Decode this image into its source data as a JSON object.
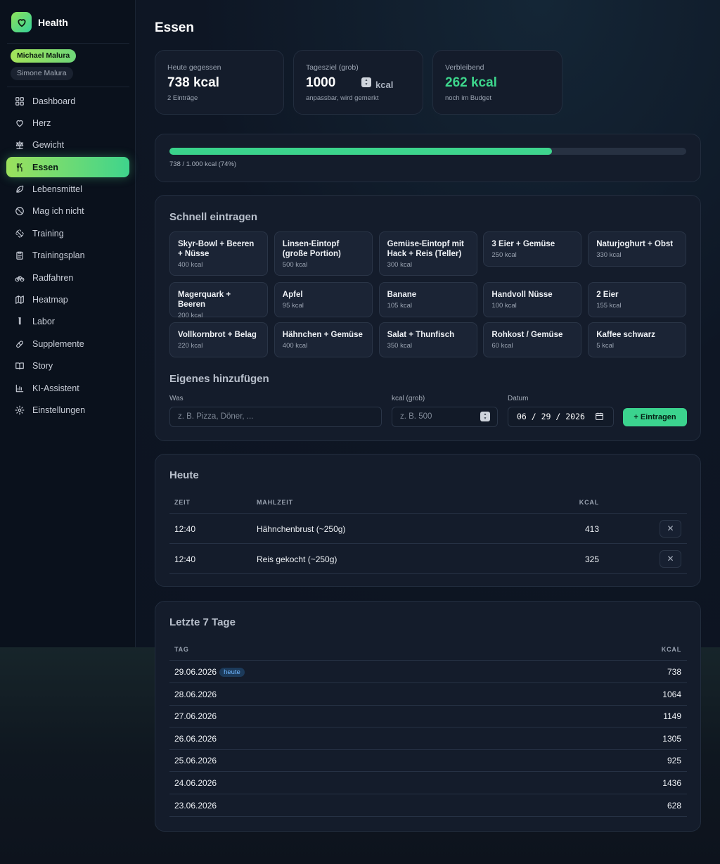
{
  "app": {
    "name": "Health"
  },
  "users": {
    "active": "Michael Malura",
    "other": "Simone Malura"
  },
  "sidebar": {
    "items": [
      {
        "label": "Dashboard",
        "icon": "dashboard-icon"
      },
      {
        "label": "Herz",
        "icon": "heart-icon"
      },
      {
        "label": "Gewicht",
        "icon": "scale-icon"
      },
      {
        "label": "Essen",
        "icon": "utensils-icon",
        "active": true
      },
      {
        "label": "Lebensmittel",
        "icon": "leaf-icon"
      },
      {
        "label": "Mag ich nicht",
        "icon": "ban-icon"
      },
      {
        "label": "Training",
        "icon": "dumbbell-icon"
      },
      {
        "label": "Trainingsplan",
        "icon": "clipboard-icon"
      },
      {
        "label": "Radfahren",
        "icon": "bike-icon"
      },
      {
        "label": "Heatmap",
        "icon": "map-icon"
      },
      {
        "label": "Labor",
        "icon": "test-tube-icon"
      },
      {
        "label": "Supplemente",
        "icon": "pill-icon"
      },
      {
        "label": "Story",
        "icon": "book-icon"
      },
      {
        "label": "KI-Assistent",
        "icon": "bar-chart-icon"
      },
      {
        "label": "Einstellungen",
        "icon": "gear-icon"
      }
    ]
  },
  "page": {
    "title": "Essen"
  },
  "stats": {
    "eaten": {
      "label": "Heute gegessen",
      "value": "738 kcal",
      "sub": "2 Einträge"
    },
    "goal": {
      "label": "Tagesziel (grob)",
      "value": "1000",
      "unit": "kcal",
      "sub": "anpassbar, wird gemerkt"
    },
    "remaining": {
      "label": "Verbleibend",
      "value": "262 kcal",
      "sub": "noch im Budget"
    }
  },
  "progress": {
    "fraction": 0.74,
    "text": "738 / 1.000 kcal (74%)"
  },
  "quick": {
    "title": "Schnell eintragen",
    "items": [
      {
        "name": "Skyr-Bowl + Beeren + Nüsse",
        "kcal": "400 kcal"
      },
      {
        "name": "Linsen-Eintopf (große Portion)",
        "kcal": "500 kcal"
      },
      {
        "name": "Gemüse-Eintopf mit Hack + Reis (Teller)",
        "kcal": "300 kcal"
      },
      {
        "name": "3 Eier + Gemüse",
        "kcal": "250 kcal"
      },
      {
        "name": "Naturjoghurt + Obst",
        "kcal": "330 kcal"
      },
      {
        "name": "Magerquark + Beeren",
        "kcal": "200 kcal"
      },
      {
        "name": "Apfel",
        "kcal": "95 kcal"
      },
      {
        "name": "Banane",
        "kcal": "105 kcal"
      },
      {
        "name": "Handvoll Nüsse",
        "kcal": "100 kcal"
      },
      {
        "name": "2 Eier",
        "kcal": "155 kcal"
      },
      {
        "name": "Vollkornbrot + Belag",
        "kcal": "220 kcal"
      },
      {
        "name": "Hähnchen + Gemüse",
        "kcal": "400 kcal"
      },
      {
        "name": "Salat + Thunfisch",
        "kcal": "350 kcal"
      },
      {
        "name": "Rohkost / Gemüse",
        "kcal": "60 kcal"
      },
      {
        "name": "Kaffee schwarz",
        "kcal": "5 kcal"
      }
    ]
  },
  "custom": {
    "title": "Eigenes hinzufügen",
    "what_label": "Was",
    "what_placeholder": "z. B. Pizza, Döner, ...",
    "kcal_label": "kcal (grob)",
    "kcal_placeholder": "z. B. 500",
    "date_label": "Datum",
    "date_value": "06 / 29 / 2026",
    "submit": "+ Eintragen"
  },
  "today": {
    "title": "Heute",
    "headers": {
      "time": "ZEIT",
      "meal": "MAHLZEIT",
      "kcal": "KCAL"
    },
    "rows": [
      {
        "time": "12:40",
        "meal": "Hähnchenbrust (~250g)",
        "kcal": "413"
      },
      {
        "time": "12:40",
        "meal": "Reis gekocht (~250g)",
        "kcal": "325"
      }
    ]
  },
  "last7": {
    "title": "Letzte 7 Tage",
    "headers": {
      "day": "TAG",
      "kcal": "KCAL"
    },
    "today_badge": "heute",
    "rows": [
      {
        "day": "29.06.2026",
        "kcal": "738"
      },
      {
        "day": "28.06.2026",
        "kcal": "1064"
      },
      {
        "day": "27.06.2026",
        "kcal": "1149"
      },
      {
        "day": "26.06.2026",
        "kcal": "1305"
      },
      {
        "day": "25.06.2026",
        "kcal": "925"
      },
      {
        "day": "24.06.2026",
        "kcal": "1436"
      },
      {
        "day": "23.06.2026",
        "kcal": "628"
      }
    ]
  },
  "colors": {
    "accent": "#3bd38e",
    "accent_lime": "#9be15d",
    "remaining": "#3dd68c"
  }
}
